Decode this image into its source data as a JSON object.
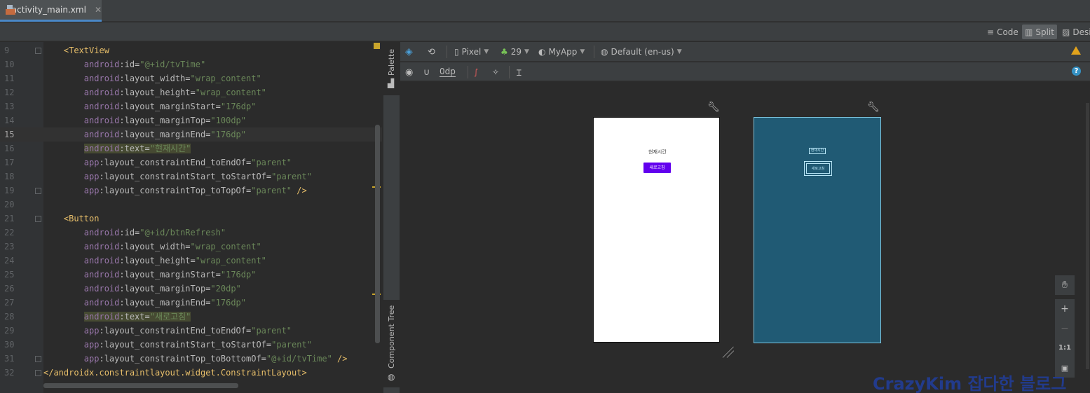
{
  "tab": {
    "label": "activity_main.xml",
    "close": "✕"
  },
  "view_modes": {
    "code": "Code",
    "split": "Split",
    "design": "Desig"
  },
  "editor": {
    "lines": [
      {
        "n": "9",
        "parts": [
          [
            "i",
            "    "
          ],
          [
            "tag",
            "<TextView"
          ]
        ]
      },
      {
        "n": "10",
        "parts": [
          [
            "i",
            "        "
          ],
          [
            "ns",
            "android"
          ],
          [
            "attr",
            ":id="
          ],
          [
            "val",
            "\"@+id/tvTime\""
          ]
        ]
      },
      {
        "n": "11",
        "parts": [
          [
            "i",
            "        "
          ],
          [
            "ns",
            "android"
          ],
          [
            "attr",
            ":layout_width="
          ],
          [
            "val",
            "\"wrap_content\""
          ]
        ]
      },
      {
        "n": "12",
        "parts": [
          [
            "i",
            "        "
          ],
          [
            "ns",
            "android"
          ],
          [
            "attr",
            ":layout_height="
          ],
          [
            "val",
            "\"wrap_content\""
          ]
        ]
      },
      {
        "n": "13",
        "parts": [
          [
            "i",
            "        "
          ],
          [
            "ns",
            "android"
          ],
          [
            "attr",
            ":layout_marginStart="
          ],
          [
            "val",
            "\"176dp\""
          ]
        ]
      },
      {
        "n": "14",
        "parts": [
          [
            "i",
            "        "
          ],
          [
            "ns",
            "android"
          ],
          [
            "attr",
            ":layout_marginTop="
          ],
          [
            "val",
            "\"100dp\""
          ]
        ]
      },
      {
        "n": "15",
        "parts": [
          [
            "i",
            "        "
          ],
          [
            "ns",
            "android"
          ],
          [
            "attr",
            ":layout_marginEnd="
          ],
          [
            "val",
            "\"176dp\""
          ]
        ]
      },
      {
        "n": "16",
        "parts": [
          [
            "i",
            "        "
          ],
          [
            "hlns",
            "android"
          ],
          [
            "hlattr",
            ":text="
          ],
          [
            "hlval",
            "\"현재시간\""
          ]
        ]
      },
      {
        "n": "17",
        "parts": [
          [
            "i",
            "        "
          ],
          [
            "ns",
            "app"
          ],
          [
            "attr",
            ":layout_constraintEnd_toEndOf="
          ],
          [
            "val",
            "\"parent\""
          ]
        ]
      },
      {
        "n": "18",
        "parts": [
          [
            "i",
            "        "
          ],
          [
            "ns",
            "app"
          ],
          [
            "attr",
            ":layout_constraintStart_toStartOf="
          ],
          [
            "val",
            "\"parent\""
          ]
        ]
      },
      {
        "n": "19",
        "parts": [
          [
            "i",
            "        "
          ],
          [
            "ns",
            "app"
          ],
          [
            "attr",
            ":layout_constraintTop_toTopOf="
          ],
          [
            "val",
            "\"parent\""
          ],
          [
            "tag",
            " />"
          ]
        ]
      },
      {
        "n": "20",
        "parts": []
      },
      {
        "n": "21",
        "parts": [
          [
            "i",
            "    "
          ],
          [
            "tag",
            "<Button"
          ]
        ]
      },
      {
        "n": "22",
        "parts": [
          [
            "i",
            "        "
          ],
          [
            "ns",
            "android"
          ],
          [
            "attr",
            ":id="
          ],
          [
            "val",
            "\"@+id/btnRefresh\""
          ]
        ]
      },
      {
        "n": "23",
        "parts": [
          [
            "i",
            "        "
          ],
          [
            "ns",
            "android"
          ],
          [
            "attr",
            ":layout_width="
          ],
          [
            "val",
            "\"wrap_content\""
          ]
        ]
      },
      {
        "n": "24",
        "parts": [
          [
            "i",
            "        "
          ],
          [
            "ns",
            "android"
          ],
          [
            "attr",
            ":layout_height="
          ],
          [
            "val",
            "\"wrap_content\""
          ]
        ]
      },
      {
        "n": "25",
        "parts": [
          [
            "i",
            "        "
          ],
          [
            "ns",
            "android"
          ],
          [
            "attr",
            ":layout_marginStart="
          ],
          [
            "val",
            "\"176dp\""
          ]
        ]
      },
      {
        "n": "26",
        "parts": [
          [
            "i",
            "        "
          ],
          [
            "ns",
            "android"
          ],
          [
            "attr",
            ":layout_marginTop="
          ],
          [
            "val",
            "\"20dp\""
          ]
        ]
      },
      {
        "n": "27",
        "parts": [
          [
            "i",
            "        "
          ],
          [
            "ns",
            "android"
          ],
          [
            "attr",
            ":layout_marginEnd="
          ],
          [
            "val",
            "\"176dp\""
          ]
        ]
      },
      {
        "n": "28",
        "parts": [
          [
            "i",
            "        "
          ],
          [
            "hlns",
            "android"
          ],
          [
            "hlattr",
            ":text="
          ],
          [
            "hlval",
            "\"새로고침\""
          ]
        ]
      },
      {
        "n": "29",
        "parts": [
          [
            "i",
            "        "
          ],
          [
            "ns",
            "app"
          ],
          [
            "attr",
            ":layout_constraintEnd_toEndOf="
          ],
          [
            "val",
            "\"parent\""
          ]
        ]
      },
      {
        "n": "30",
        "parts": [
          [
            "i",
            "        "
          ],
          [
            "ns",
            "app"
          ],
          [
            "attr",
            ":layout_constraintStart_toStartOf="
          ],
          [
            "val",
            "\"parent\""
          ]
        ]
      },
      {
        "n": "31",
        "parts": [
          [
            "i",
            "        "
          ],
          [
            "ns",
            "app"
          ],
          [
            "attr",
            ":layout_constraintTop_toBottomOf="
          ],
          [
            "val",
            "\"@+id/tvTime\""
          ],
          [
            "tag",
            " />"
          ]
        ]
      },
      {
        "n": "32",
        "parts": [
          [
            "tag",
            "</androidx.constraintlayout.widget.ConstraintLayout>"
          ]
        ]
      }
    ],
    "current_line": "15"
  },
  "side_tabs": {
    "palette": "Palette",
    "component_tree": "Component Tree"
  },
  "toolbar": {
    "device": "Pixel",
    "api": "29",
    "theme": "MyApp",
    "locale": "Default (en-us)",
    "margin": "0dp"
  },
  "preview": {
    "text_view": "현재시간",
    "button": "새로고침",
    "button_color": "#6200ee",
    "blueprint_color": "#205a74"
  },
  "zoom": {
    "zoom_in": "+",
    "zoom_out": "−",
    "actual_size": "1:1"
  },
  "watermark": "CrazyKim 잡다한 블로그"
}
